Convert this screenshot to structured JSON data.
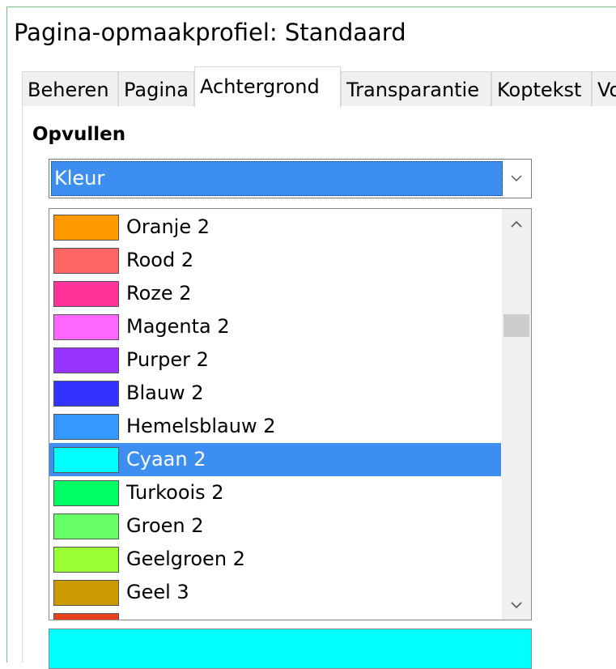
{
  "window": {
    "title": "Pagina-opmaakprofiel: Standaard"
  },
  "tabs": [
    {
      "label": "Beheren",
      "active": false
    },
    {
      "label": "Pagina",
      "active": false
    },
    {
      "label": "Achtergrond",
      "active": true
    },
    {
      "label": "Transparantie",
      "active": false
    },
    {
      "label": "Koptekst",
      "active": false
    },
    {
      "label": "Voettekst",
      "active": false
    }
  ],
  "fill": {
    "section_label": "Opvullen",
    "type_value": "Kleur",
    "colors": [
      {
        "name": "Oranje 2",
        "color": "#ff9900",
        "selected": false
      },
      {
        "name": "Rood 2",
        "color": "#ff6666",
        "selected": false
      },
      {
        "name": "Roze 2",
        "color": "#ff3399",
        "selected": false
      },
      {
        "name": "Magenta 2",
        "color": "#ff66ff",
        "selected": false
      },
      {
        "name": "Purper 2",
        "color": "#9933ff",
        "selected": false
      },
      {
        "name": "Blauw 2",
        "color": "#3333ff",
        "selected": false
      },
      {
        "name": "Hemelsblauw 2",
        "color": "#3399ff",
        "selected": false
      },
      {
        "name": "Cyaan 2",
        "color": "#00ffff",
        "selected": true
      },
      {
        "name": "Turkoois 2",
        "color": "#00ff66",
        "selected": false
      },
      {
        "name": "Groen 2",
        "color": "#66ff66",
        "selected": false
      },
      {
        "name": "Geelgroen 2",
        "color": "#99ff33",
        "selected": false
      },
      {
        "name": "Geel 3",
        "color": "#cc9900",
        "selected": false
      },
      {
        "name": "",
        "color": "#e8401c",
        "selected": false
      }
    ],
    "preview_color": "#00ffff"
  },
  "colors": {
    "accent": "#3c8ff0",
    "window_border": "#7fbf7f"
  }
}
